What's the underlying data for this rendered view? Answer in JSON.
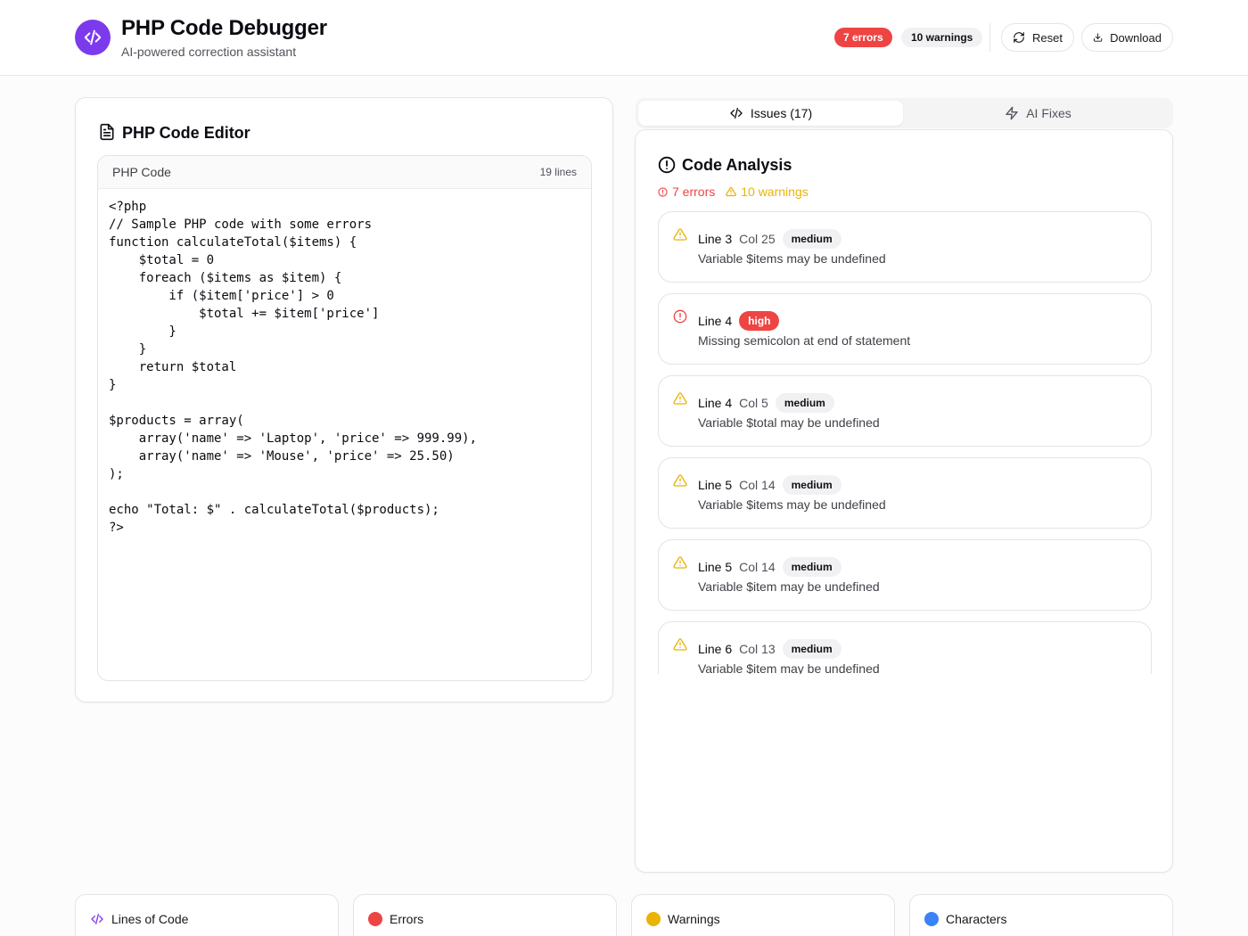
{
  "header": {
    "title": "PHP Code Debugger",
    "subtitle": "AI-powered correction assistant",
    "errors_badge": "7 errors",
    "warnings_badge": "10 warnings",
    "reset_label": "Reset",
    "download_label": "Download",
    "logo_icon": "code-icon",
    "accent_color": "#7c3aed"
  },
  "editor": {
    "title": "PHP Code Editor",
    "code_label": "PHP Code",
    "line_count": "19 lines",
    "code": "<?php\n// Sample PHP code with some errors\nfunction calculateTotal($items) {\n    $total = 0\n    foreach ($items as $item) {\n        if ($item['price'] > 0\n            $total += $item['price']\n        }\n    }\n    return $total\n}\n\n$products = array(\n    array('name' => 'Laptop', 'price' => 999.99),\n    array('name' => 'Mouse', 'price' => 25.50)\n);\n\necho \"Total: $\" . calculateTotal($products);\n?>"
  },
  "tabs": [
    {
      "label": "Issues (17)",
      "icon": "code-icon",
      "active": true
    },
    {
      "label": "AI Fixes",
      "icon": "lightning-icon",
      "active": false
    }
  ],
  "analysis": {
    "title": "Code Analysis",
    "errors_summary": "7 errors",
    "warnings_summary": "10 warnings",
    "issues": [
      {
        "line": "Line 3",
        "col": "Col 25",
        "severity": "medium",
        "message": "Variable $items may be undefined",
        "icon": "warning-triangle-icon"
      },
      {
        "line": "Line 4",
        "col": "",
        "severity": "high",
        "message": "Missing semicolon at end of statement",
        "icon": "error-circle-icon"
      },
      {
        "line": "Line 4",
        "col": "Col 5",
        "severity": "medium",
        "message": "Variable $total may be undefined",
        "icon": "warning-triangle-icon"
      },
      {
        "line": "Line 5",
        "col": "Col 14",
        "severity": "medium",
        "message": "Variable $items may be undefined",
        "icon": "warning-triangle-icon"
      },
      {
        "line": "Line 5",
        "col": "Col 14",
        "severity": "medium",
        "message": "Variable $item may be undefined",
        "icon": "warning-triangle-icon"
      },
      {
        "line": "Line 6",
        "col": "Col 13",
        "severity": "medium",
        "message": "Variable $item may be undefined",
        "icon": "warning-triangle-icon"
      }
    ]
  },
  "stats": [
    {
      "label": "Lines of Code",
      "icon": "code-icon",
      "color": "#7c3aed"
    },
    {
      "label": "Errors",
      "icon": "red-dot",
      "color": "#ef4444"
    },
    {
      "label": "Warnings",
      "icon": "yellow-dot",
      "color": "#eab308"
    },
    {
      "label": "Characters",
      "icon": "blue-dot",
      "color": "#3b82f6"
    }
  ]
}
